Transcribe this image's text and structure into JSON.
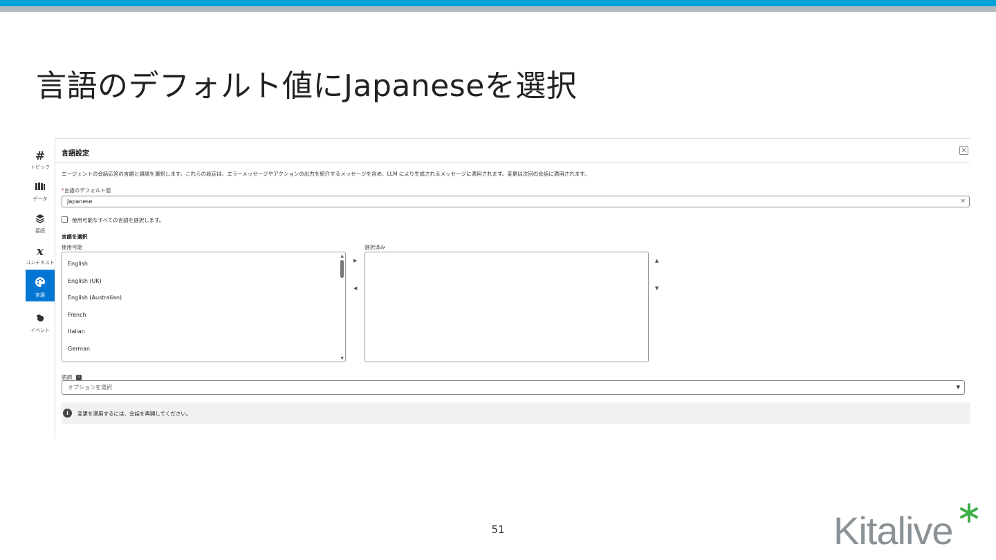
{
  "slide": {
    "title": "言語のデフォルト値にJapaneseを選択",
    "page_number": "51",
    "logo_text": "Kitalive"
  },
  "sidebar": {
    "items": [
      {
        "label": "トピック",
        "icon": "hash-icon"
      },
      {
        "label": "データ",
        "icon": "library-icon"
      },
      {
        "label": "接続",
        "icon": "layers-icon"
      },
      {
        "label": "コンテキスト",
        "icon": "variable-icon"
      },
      {
        "label": "言語",
        "icon": "palette-icon",
        "active": true
      },
      {
        "label": "イベント",
        "icon": "event-icon"
      }
    ]
  },
  "panel": {
    "title": "言語設定",
    "close": "×",
    "description": "エージェントの会話応答の言語と語調を選択します。これらの設定は、エラーメッセージやアクションの出力を紹介するメッセージを含め、LLM により生成されるメッセージに適用されます。変更は次回の会話に適用されます。",
    "default_language_label": "言語のデフォルト値",
    "required_mark": "*",
    "default_language_value": "Japanese",
    "clear": "×",
    "select_all_label": "使用可能なすべての言語を選択します。",
    "select_languages_label": "言語を選択",
    "available_label": "使用可能",
    "selected_label": "選択済み",
    "available_languages": [
      "English",
      "English (UK)",
      "English (Australian)",
      "French",
      "Italian",
      "German"
    ],
    "tone_label": "語調",
    "tone_placeholder": "オプションを選択",
    "notice": "変更を適用するには、会話を再開してください。"
  },
  "colors": {
    "top_bar": "#00a3d9",
    "accent": "#0176d3",
    "logo_gray": "#8a9296",
    "logo_green": "#3fae49"
  }
}
